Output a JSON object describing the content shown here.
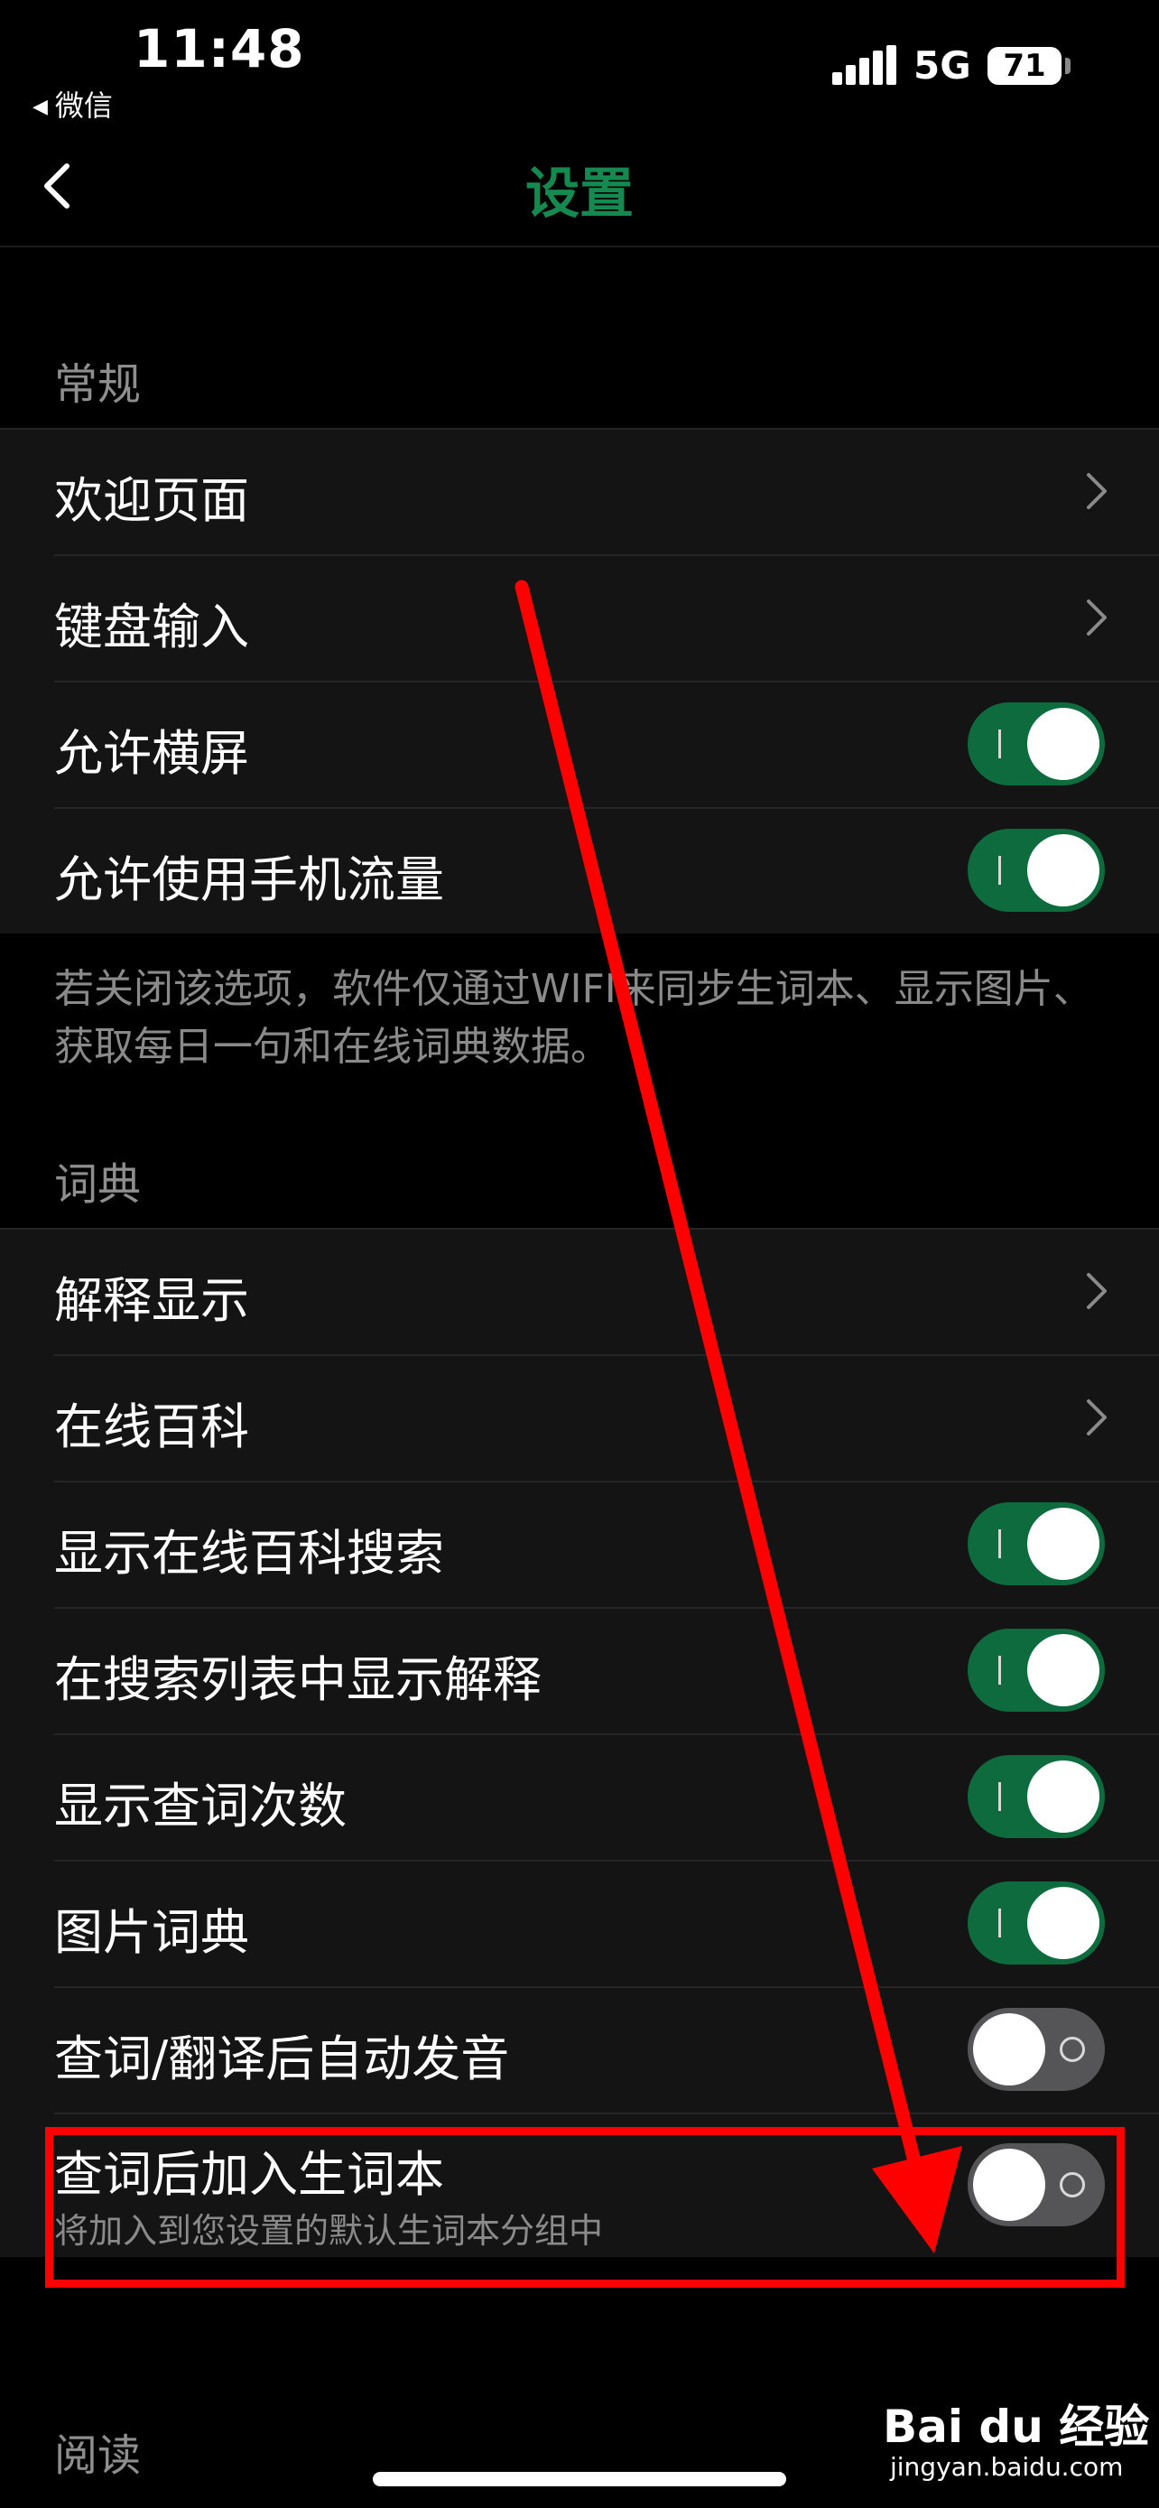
{
  "status": {
    "time": "11:48",
    "back_app": "微信",
    "network": "5G",
    "battery": "71"
  },
  "nav": {
    "title": "设置"
  },
  "sections": {
    "general": {
      "header": "常规",
      "items": [
        {
          "label": "欢迎页面"
        },
        {
          "label": "键盘输入"
        },
        {
          "label": "允许横屏",
          "toggle": true
        },
        {
          "label": "允许使用手机流量",
          "toggle": true
        }
      ],
      "footnote": "若关闭该选项，软件仅通过WIFI来同步生词本、显示图片、获取每日一句和在线词典数据。"
    },
    "dictionary": {
      "header": "词典",
      "items": [
        {
          "label": "解释显示"
        },
        {
          "label": "在线百科"
        },
        {
          "label": "显示在线百科搜索",
          "toggle": true
        },
        {
          "label": "在搜索列表中显示解释",
          "toggle": true
        },
        {
          "label": "显示查词次数",
          "toggle": true
        },
        {
          "label": "图片词典",
          "toggle": true
        },
        {
          "label": "查词/翻译后自动发音",
          "toggle": false
        },
        {
          "label": "查词后加入生词本",
          "subtitle": "将加入到您设置的默认生词本分组中",
          "toggle": false
        }
      ]
    },
    "reading": {
      "header": "阅读"
    }
  },
  "watermark": {
    "brand": "Bai du 经验",
    "url": "jingyan.baidu.com"
  },
  "colors": {
    "accent": "#148a50",
    "toggle_on": "#0d6b3e",
    "annotation": "#ff0000"
  }
}
